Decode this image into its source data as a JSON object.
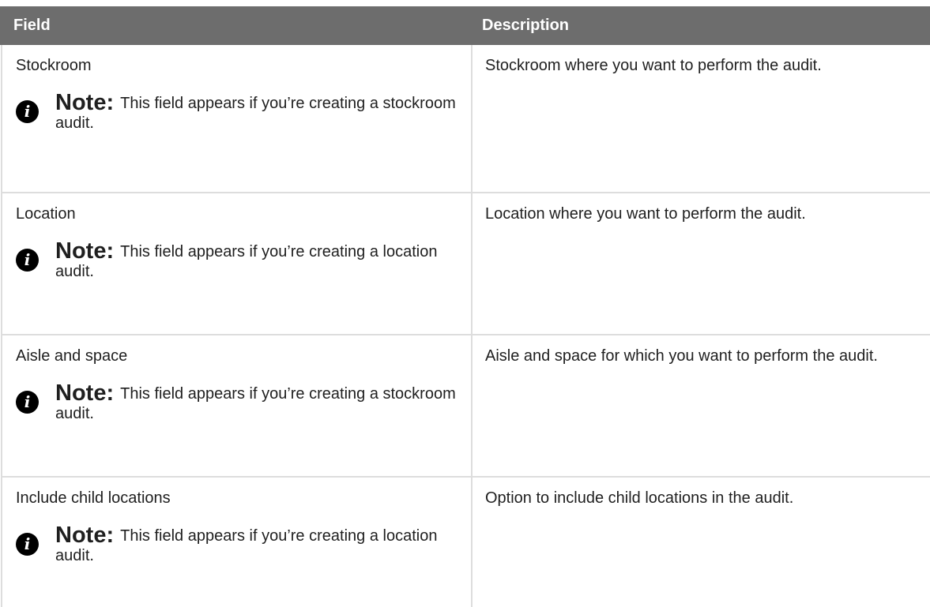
{
  "table": {
    "headers": {
      "field": "Field",
      "description": "Description"
    },
    "rows": [
      {
        "field": "Stockroom",
        "note_title": "Note:",
        "note_text": "This field appears if you’re creating a stockroom audit.",
        "description": "Stockroom where you want to perform the audit."
      },
      {
        "field": "Location",
        "note_title": "Note:",
        "note_text": "This field appears if you’re creating a location audit.",
        "description": "Location where you want to perform the audit."
      },
      {
        "field": "Aisle and space",
        "note_title": "Note:",
        "note_text": "This field appears if you’re creating a stockroom audit.",
        "description": "Aisle and space for which you want to perform the audit."
      },
      {
        "field": "Include child locations",
        "note_title": "Note:",
        "note_text": "This field appears if you’re creating a location audit.",
        "description": "Option to include child locations in the audit."
      }
    ]
  },
  "icons": {
    "note": "info-icon",
    "note_glyph": "i"
  },
  "colors": {
    "header_bg": "#6d6d6d",
    "header_text": "#ffffff",
    "border": "#dddddd",
    "icon_bg": "#000000"
  }
}
